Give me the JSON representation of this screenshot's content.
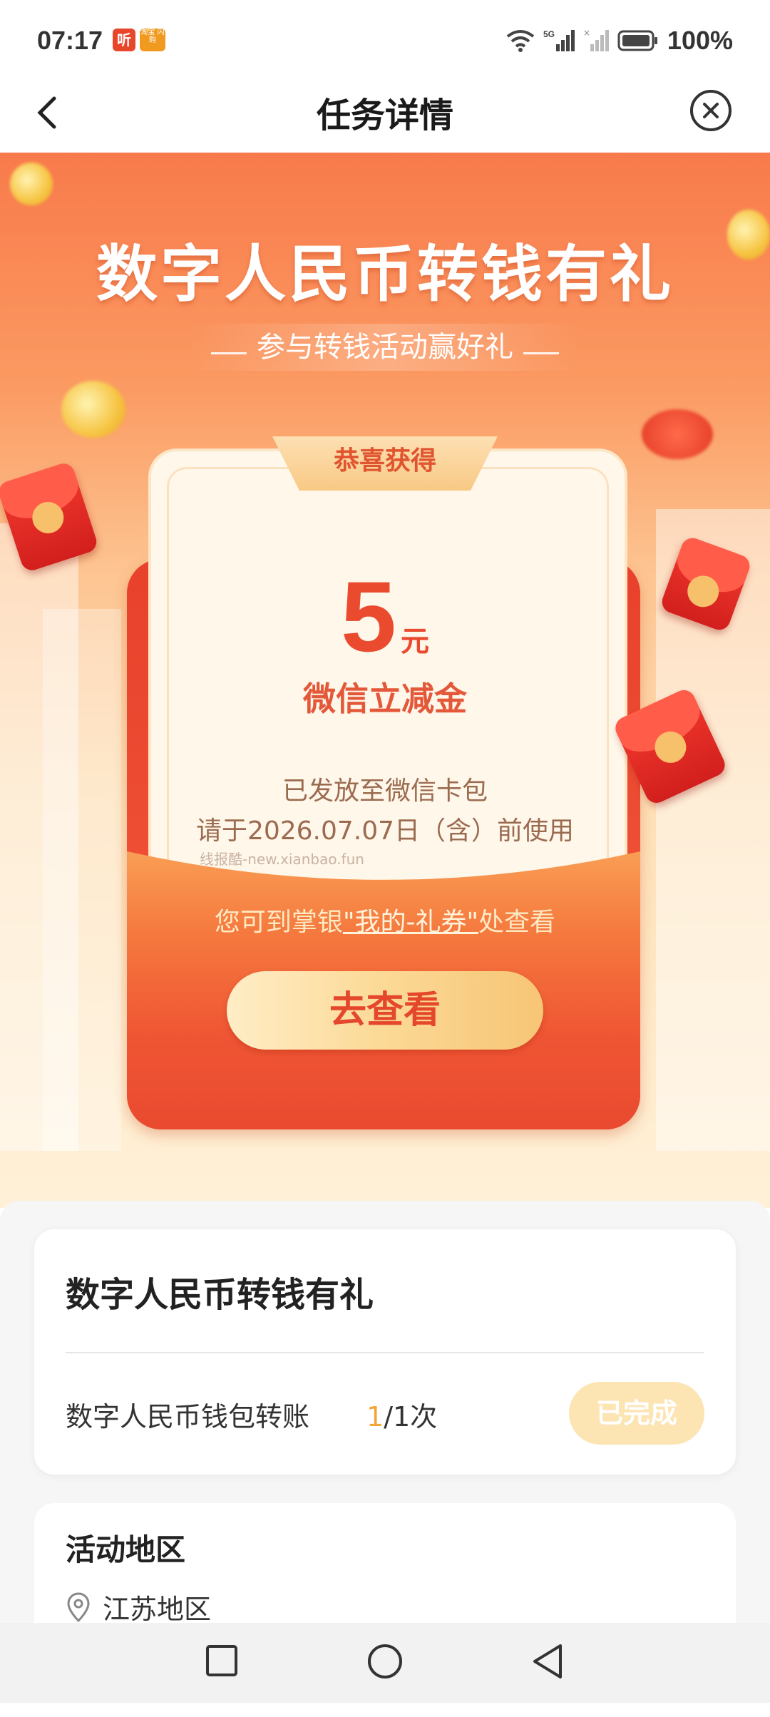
{
  "status_bar": {
    "time": "07:17",
    "app1_label": "听",
    "app2_label": "淘宝\n闪购",
    "network": "5G",
    "battery": "100%"
  },
  "header": {
    "title": "任务详情"
  },
  "hero": {
    "title": "数字人民币转钱有礼",
    "subtitle": "参与转钱活动赢好礼",
    "ribbon": "恭喜获得",
    "amount": "5",
    "amount_unit": "元",
    "reward_name": "微信立减金",
    "issued_note": "已发放至微信卡包",
    "expire_note": "请于2026.07.07日（含）前使用",
    "watermark": "线报酷-new.xianbao.fun",
    "check_prefix": "您可到掌银",
    "check_link": "\"我的-礼券\"",
    "check_suffix": "处查看",
    "go_button": "去查看"
  },
  "task": {
    "title": "数字人民币转钱有礼",
    "name": "数字人民币钱包转账",
    "count_done": "1",
    "count_total": "/1次",
    "status_button": "已完成"
  },
  "region": {
    "title": "活动地区",
    "value": "江苏地区"
  },
  "colors": {
    "accent": "#ea4a2e",
    "hero_top": "#f87a4b",
    "done_button": "#fde4b3"
  }
}
